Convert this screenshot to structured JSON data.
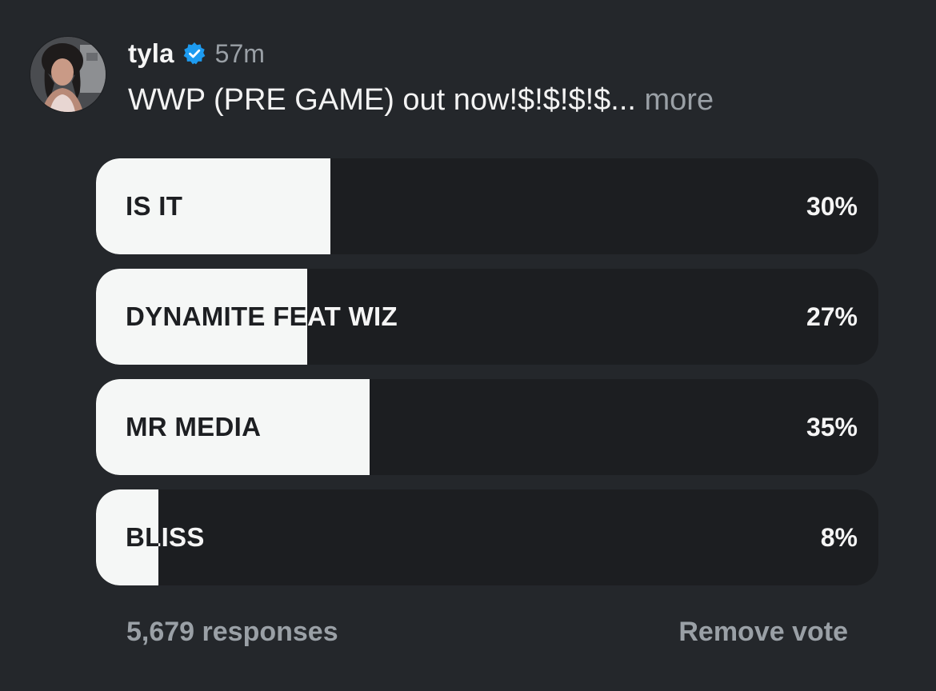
{
  "post": {
    "username": "tyla",
    "time": "57m",
    "caption": "WWP (PRE GAME) out now!$!$!$!$...",
    "more": " more",
    "verified_color": "#1d9bf0"
  },
  "poll": {
    "options": [
      {
        "label": "IS IT",
        "percent_text": "30%",
        "percent": 30
      },
      {
        "label": "DYNAMITE FEAT WIZ",
        "percent_text": "27%",
        "percent": 27
      },
      {
        "label": "MR MEDIA",
        "percent_text": "35%",
        "percent": 35
      },
      {
        "label": "BLISS",
        "percent_text": "8%",
        "percent": 8
      }
    ],
    "responses": "5,679 responses",
    "remove_vote": "Remove vote"
  }
}
